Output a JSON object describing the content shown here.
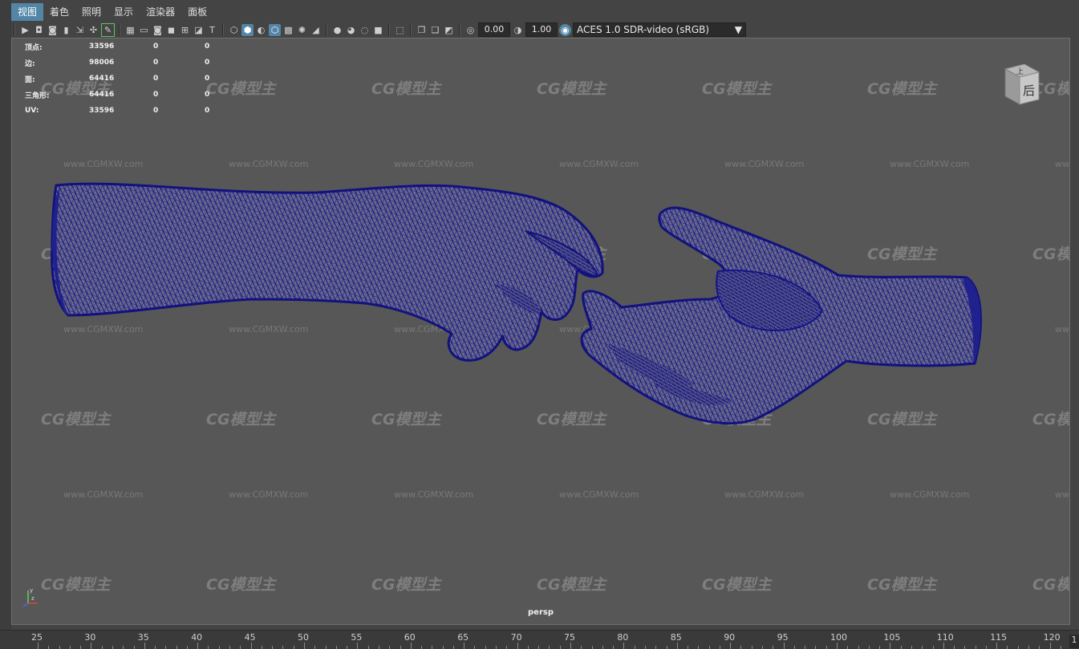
{
  "menu": [
    "视图",
    "着色",
    "照明",
    "显示",
    "渲染器",
    "面板"
  ],
  "toolbar": {
    "exposure": "0.00",
    "gamma": "1.00",
    "color_space": "ACES 1.0 SDR-video (sRGB)"
  },
  "hud": {
    "rows": [
      {
        "label": "顶点:",
        "total": "33596",
        "selected": "0",
        "selected_obj": "0"
      },
      {
        "label": "边:",
        "total": "98006",
        "selected": "0",
        "selected_obj": "0"
      },
      {
        "label": "面:",
        "total": "64416",
        "selected": "0",
        "selected_obj": "0"
      },
      {
        "label": "三角形:",
        "total": "64416",
        "selected": "0",
        "selected_obj": "0"
      },
      {
        "label": "UV:",
        "total": "33596",
        "selected": "0",
        "selected_obj": "0"
      }
    ]
  },
  "viewcube": {
    "top": "上",
    "front": "后"
  },
  "camera_name": "persp",
  "watermark": {
    "logo": "CG模型主",
    "url": "www.CGMXW.com"
  },
  "timeline": {
    "ticks": [
      "25",
      "30",
      "35",
      "40",
      "45",
      "50",
      "55",
      "60",
      "65",
      "70",
      "75",
      "80",
      "85",
      "90",
      "95",
      "100",
      "105",
      "110",
      "115",
      "120"
    ],
    "current_frame": "1"
  },
  "colors": {
    "mesh_wire": "#16168a",
    "mesh_fill": "#6b6b8c",
    "viewport_bg": "#575757",
    "highlight": "#5285a6"
  }
}
